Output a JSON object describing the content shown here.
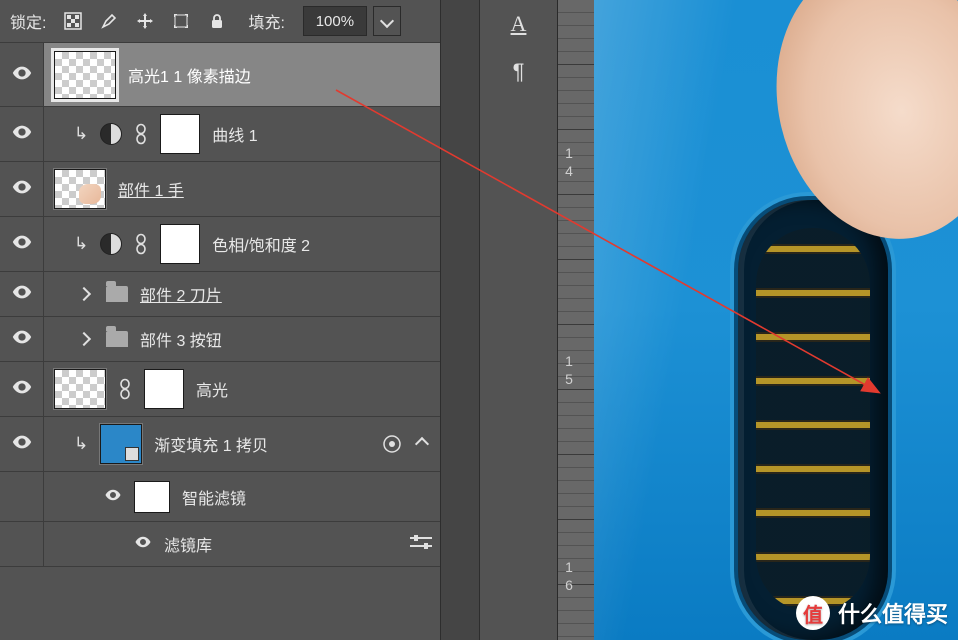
{
  "lockbar": {
    "label": "锁定:",
    "fill_label": "填充:",
    "fill_value": "100%"
  },
  "layers": {
    "l0": {
      "name": "高光1 1 像素描边"
    },
    "l1": {
      "name": "曲线 1"
    },
    "l2": {
      "name": "部件 1 手"
    },
    "l3": {
      "name": "色相/饱和度 2"
    },
    "l4": {
      "name": "部件 2 刀片"
    },
    "l5": {
      "name": "部件 3 按钮"
    },
    "l6": {
      "name": "高光"
    },
    "l7": {
      "name": "渐变填充 1 拷贝"
    },
    "l8": {
      "name": "智能滤镜"
    },
    "l9": {
      "name": "滤镜库"
    }
  },
  "tool_icons": {
    "type": "A",
    "pilcrow": "¶"
  },
  "ruler_labels": {
    "r14_a": "1",
    "r14_b": "4",
    "r15_a": "1",
    "r15_b": "5",
    "r16_a": "1",
    "r16_b": "6"
  },
  "watermark": {
    "badge": "值",
    "text": "什么值得买"
  }
}
